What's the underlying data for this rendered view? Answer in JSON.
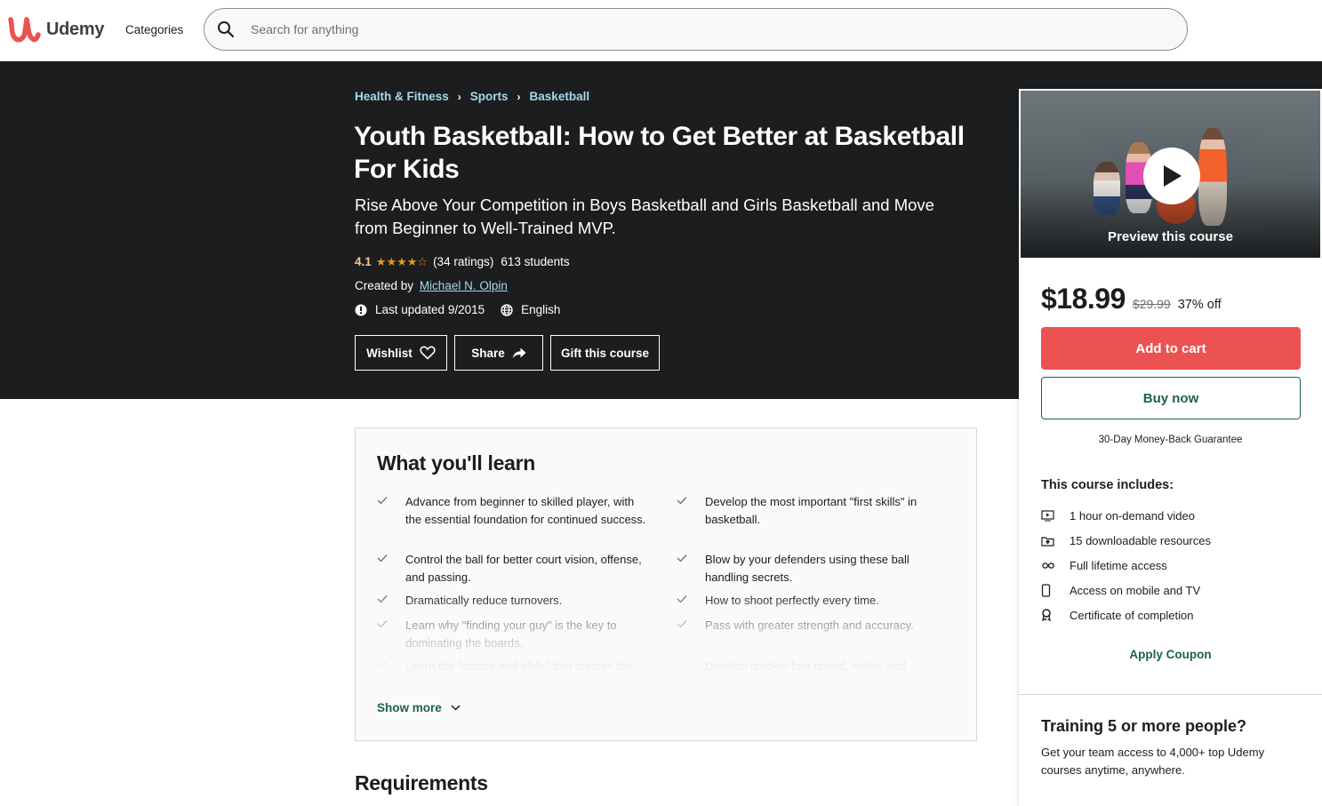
{
  "header": {
    "brand": "Udemy",
    "brand_color": "#ec5252",
    "categories_label": "Categories",
    "search_placeholder": "Search for anything",
    "search_value": ""
  },
  "hero": {
    "breadcrumb": [
      "Health & Fitness",
      "Sports",
      "Basketball"
    ],
    "title": "Youth Basketball: How to Get Better at Basketball For Kids",
    "subtitle": "Rise Above Your Competition in Boys Basketball and Girls Basketball and Move from Beginner to Well-Trained MVP.",
    "rating": "4.1",
    "rating_value": 4.1,
    "rating_max": 5,
    "ratings_count": "(34 ratings)",
    "students": "613 students",
    "created_by_label": "Created by",
    "instructor": "Michael N. Olpin",
    "last_updated": "Last updated 9/2015",
    "language": "English",
    "buttons": {
      "wishlist": "Wishlist",
      "share": "Share",
      "gift": "Gift this course"
    }
  },
  "sidebar": {
    "preview_label": "Preview this course",
    "price": "$18.99",
    "original_price": "$29.99",
    "discount": "37% off",
    "add_to_cart": "Add to cart",
    "buy_now": "Buy now",
    "guarantee": "30-Day Money-Back Guarantee",
    "includes_title": "This course includes:",
    "includes": [
      {
        "icon": "video-icon",
        "label": "1 hour on-demand video"
      },
      {
        "icon": "download-folder-icon",
        "label": "15 downloadable resources"
      },
      {
        "icon": "infinity-icon",
        "label": "Full lifetime access"
      },
      {
        "icon": "mobile-icon",
        "label": "Access on mobile and TV"
      },
      {
        "icon": "certificate-icon",
        "label": "Certificate of completion"
      }
    ],
    "apply_coupon": "Apply Coupon",
    "training_title": "Training 5 or more people?",
    "training_text": "Get your team access to 4,000+ top Udemy courses anytime, anywhere."
  },
  "learn": {
    "title": "What you'll learn",
    "left": [
      "Advance from beginner to skilled player, with the essential foundation for continued success.",
      "Control the ball for better court vision, offense, and passing.",
      "Dramatically reduce turnovers.",
      "Learn why \"finding your guy\" is the key to dominating the boards.",
      "Learn the \"stance and slide\" that creates the best and most dreaded defenders."
    ],
    "right": [
      "Develop the most important \"first skills\" in basketball.",
      "Blow by your defenders using these ball handling secrets.",
      "How to shoot perfectly every time.",
      "Pass with greater strength and accuracy.",
      "Develop quicker foot speed, agility, and increased vertical leap."
    ],
    "show_more": "Show more"
  },
  "requirements": {
    "title": "Requirements"
  }
}
